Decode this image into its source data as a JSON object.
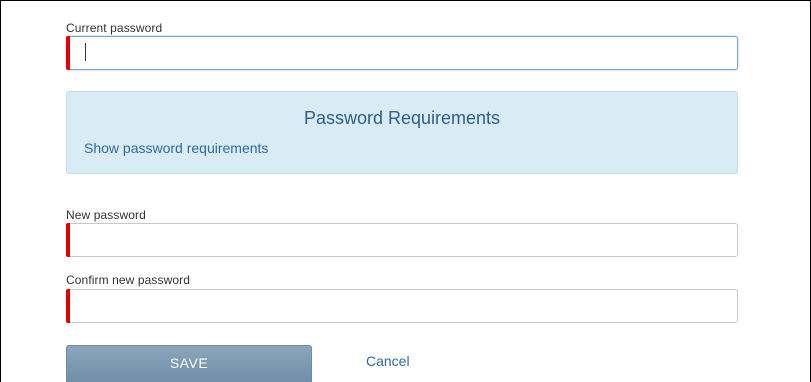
{
  "form": {
    "current_password": {
      "label": "Current password",
      "value": ""
    },
    "requirements": {
      "title": "Password Requirements",
      "link": "Show password requirements"
    },
    "new_password": {
      "label": "New password",
      "value": ""
    },
    "confirm_password": {
      "label": "Confirm new password",
      "value": ""
    },
    "save_label": "SAVE",
    "cancel_label": "Cancel"
  },
  "colors": {
    "required_indicator": "#e00000",
    "requirements_bg": "#d9ebf4",
    "requirements_title": "#2f5f8a",
    "link": "#2f6a9e",
    "save_button": "#7f9bb3"
  }
}
